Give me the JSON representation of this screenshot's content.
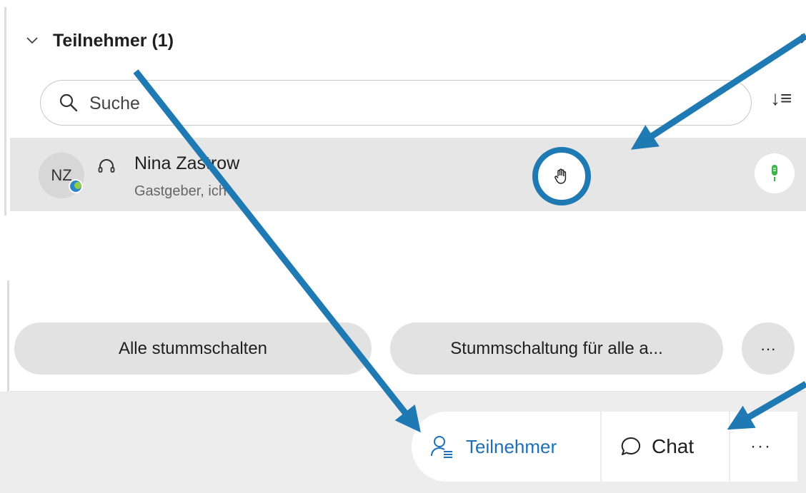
{
  "panel": {
    "title": "Teilnehmer (1)",
    "close_glyph": "×",
    "sort_glyph": "↓≡"
  },
  "search": {
    "placeholder": "Suche"
  },
  "participant": {
    "initials": "NZ",
    "name": "Nina Zastrow",
    "role": "Gastgeber, ich",
    "icons": [
      "headset-icon",
      "raised-hand-icon",
      "microphone-icon"
    ],
    "mic_color": "#3bb54a"
  },
  "actions": {
    "mute_all": "Alle stummschalten",
    "unmute_all": "Stummschaltung für alle a...",
    "more": "···"
  },
  "toolbar": {
    "participants": "Teilnehmer",
    "chat": "Chat",
    "more": "···"
  },
  "colors": {
    "accent": "#1f7ab3",
    "participants_active": "#1d6fb8",
    "row_bg": "#e6e6e6",
    "footer_bg": "#ededed"
  },
  "annotations": {
    "arrow_count": 3,
    "highlight_target": "raised-hand-icon"
  }
}
